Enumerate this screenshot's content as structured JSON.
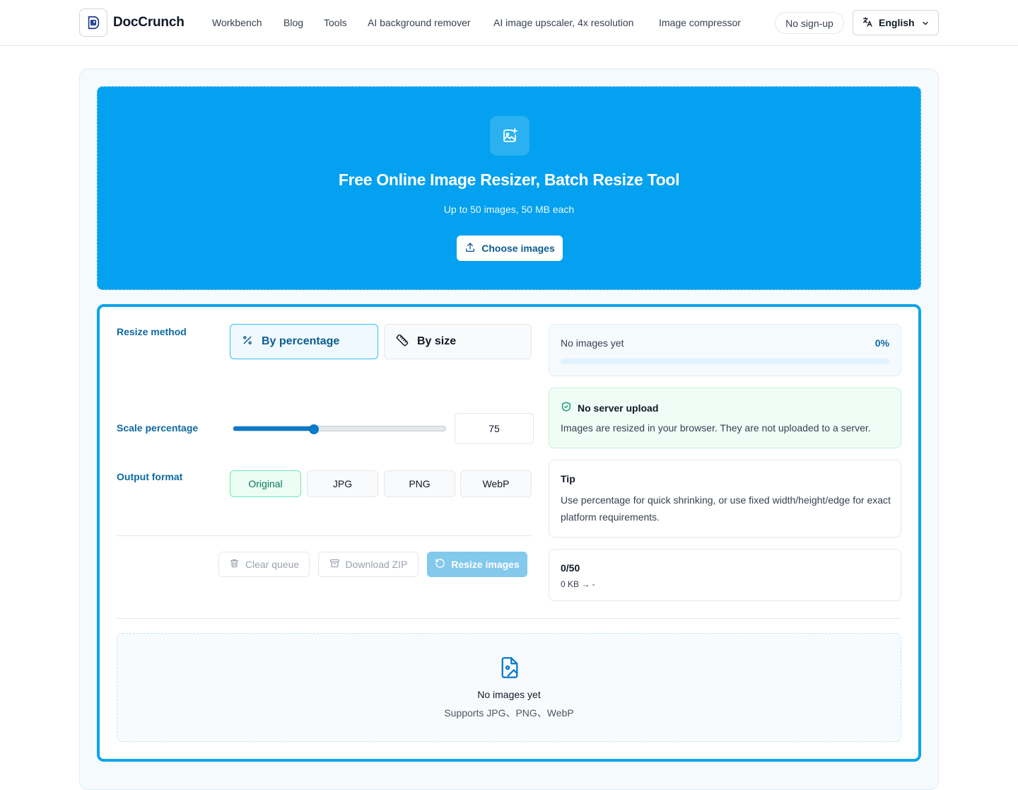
{
  "brand": {
    "name": "DocCrunch",
    "logo_icon": "doccrunch-logo-icon"
  },
  "nav": {
    "links": [
      "Workbench",
      "Blog",
      "Tools",
      "AI background remover",
      "AI image upscaler, 4x resolution",
      "Image compressor"
    ],
    "badge": "No sign-up",
    "language": "English"
  },
  "hero": {
    "title": "Free Online Image Resizer, Batch Resize Tool",
    "subtitle": "Up to 50 images, 50 MB each",
    "choose_label": "Choose images"
  },
  "settings": {
    "resize_method_label": "Resize method",
    "methods": [
      {
        "label": "By percentage",
        "icon": "percent-icon",
        "active": true
      },
      {
        "label": "By size",
        "icon": "ruler-icon",
        "active": false
      }
    ],
    "scale_label": "Scale percentage",
    "scale_value": "75",
    "scale_fraction": 0.38,
    "format_label": "Output format",
    "formats": [
      {
        "label": "Original",
        "active": true
      },
      {
        "label": "JPG",
        "active": false
      },
      {
        "label": "PNG",
        "active": false
      },
      {
        "label": "WebP",
        "active": false
      }
    ]
  },
  "actions": {
    "clear": "Clear queue",
    "download": "Download ZIP",
    "resize": "Resize images"
  },
  "status": {
    "progress_text": "No images yet",
    "progress_pct": "0%",
    "progress_value": 0,
    "safe_title": "No server upload",
    "safe_body": "Images are resized in your browser. They are not uploaded to a server.",
    "tip_title": "Tip",
    "tip_body": "Use percentage for quick shrinking, or use fixed width/height/edge for exact platform requirements.",
    "count": "0/50",
    "size_summary": "0 KB → -"
  },
  "empty": {
    "title": "No images yet",
    "subtitle": "Supports JPG、PNG、WebP"
  },
  "colors": {
    "accent": "#03a1ef",
    "accent_dark": "#0a7ac9",
    "success_bg": "#f0fdf6",
    "format_active": "#047857"
  }
}
